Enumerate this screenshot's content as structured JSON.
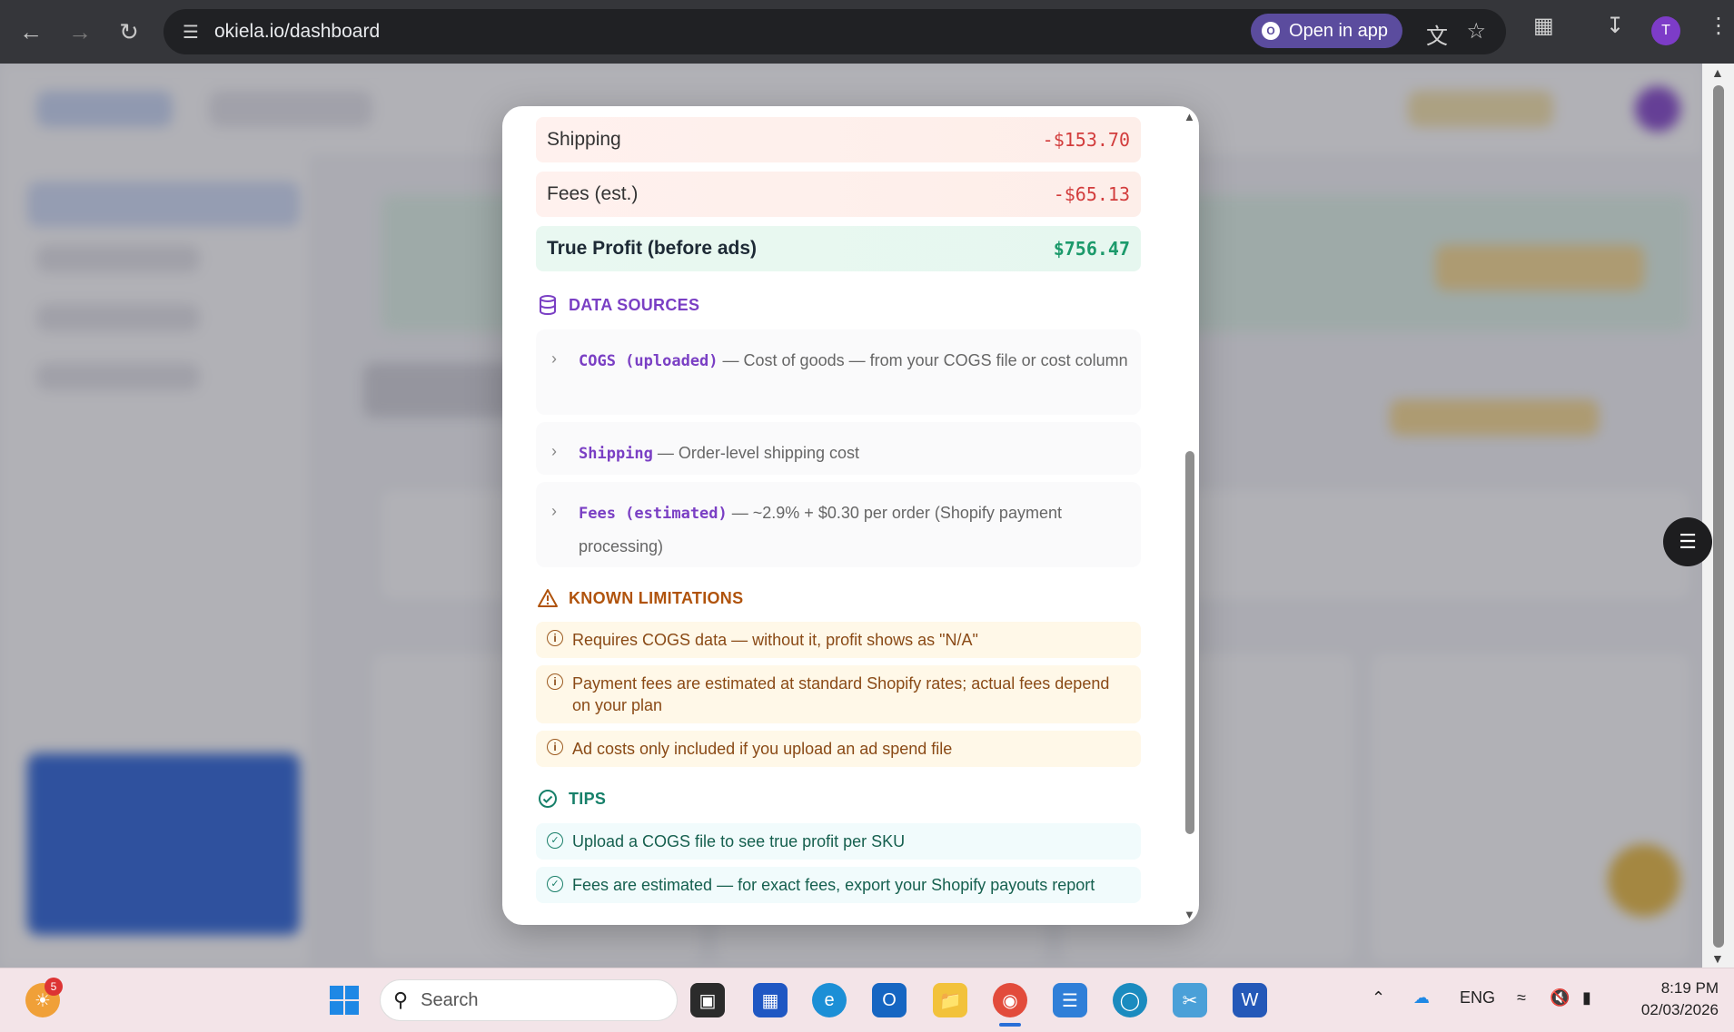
{
  "browser": {
    "url": "okiela.io/dashboard",
    "open_in_app_label": "Open in app",
    "profile_initial": "T"
  },
  "modal": {
    "rows": [
      {
        "label": "Shipping",
        "value": "-$153.70"
      },
      {
        "label": "Fees (est.)",
        "value": "-$65.13"
      },
      {
        "label": "True Profit (before ads)",
        "value": "$756.47"
      }
    ],
    "data_sources": {
      "heading": "DATA SOURCES",
      "items": [
        {
          "code": "COGS (uploaded)",
          "desc": " — Cost of goods — from your COGS file or cost column"
        },
        {
          "code": "Shipping",
          "desc": " — Order-level shipping cost"
        },
        {
          "code": "Fees (estimated)",
          "desc": " — ~2.9% + $0.30 per order (Shopify payment processing)"
        }
      ]
    },
    "known_limitations": {
      "heading": "KNOWN LIMITATIONS",
      "items": [
        "Requires COGS data — without it, profit shows as \"N/A\"",
        "Payment fees are estimated at standard Shopify rates; actual fees depend on your plan",
        "Ad costs only included if you upload an ad spend file"
      ]
    },
    "tips": {
      "heading": "TIPS",
      "items": [
        "Upload a COGS file to see true profit per SKU",
        "Fees are estimated — for exact fees, export your Shopify payouts report"
      ]
    }
  },
  "taskbar": {
    "search_placeholder": "Search",
    "notification_count": "5",
    "language": "ENG",
    "time": "8:19 PM",
    "date": "02/03/2026"
  }
}
